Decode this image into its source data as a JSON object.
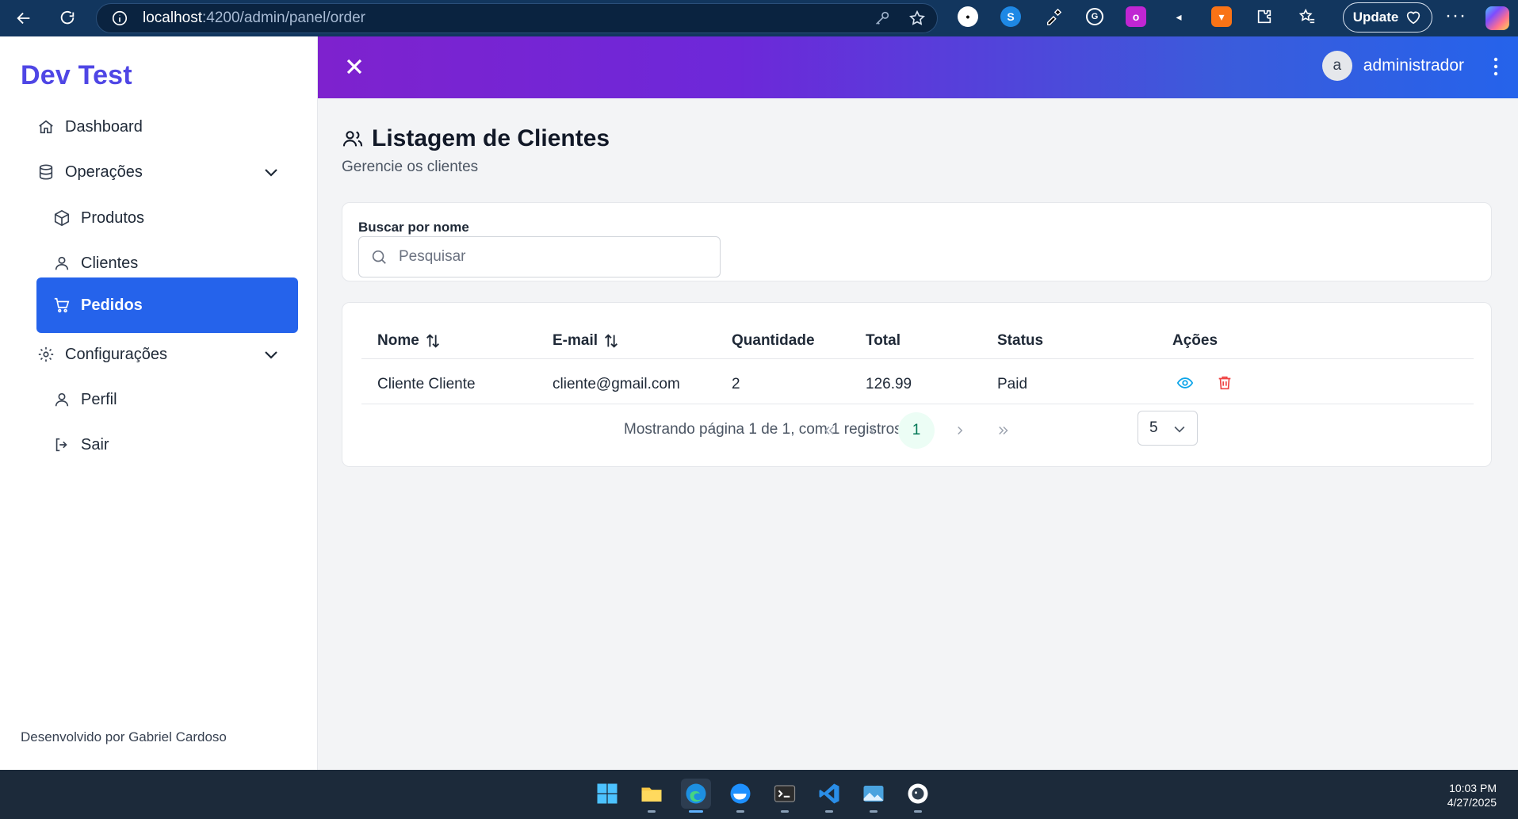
{
  "browser": {
    "url_host": "localhost",
    "url_path": ":4200/admin/panel/order",
    "update_label": "Update"
  },
  "sidebar": {
    "brand": "Dev Test",
    "items": [
      {
        "label": "Dashboard",
        "icon": "home-icon"
      },
      {
        "label": "Operações",
        "icon": "database-icon"
      },
      {
        "label": "Produtos",
        "icon": "box-icon"
      },
      {
        "label": "Clientes",
        "icon": "user-icon"
      },
      {
        "label": "Pedidos",
        "icon": "cart-icon"
      },
      {
        "label": "Configurações",
        "icon": "gear-icon"
      },
      {
        "label": "Perfil",
        "icon": "user-icon"
      },
      {
        "label": "Sair",
        "icon": "logout-icon"
      }
    ],
    "footer": "Desenvolvido por Gabriel Cardoso"
  },
  "topbar": {
    "avatar_letter": "a",
    "username": "administrador"
  },
  "page": {
    "title": "Listagem de Clientes",
    "subtitle": "Gerencie os clientes"
  },
  "search": {
    "label": "Buscar por nome",
    "placeholder": "Pesquisar",
    "value": ""
  },
  "table": {
    "columns": [
      "Nome",
      "E-mail",
      "Quantidade",
      "Total",
      "Status",
      "Ações"
    ],
    "rows": [
      {
        "nome": "Cliente Cliente",
        "email": "cliente@gmail.com",
        "quantidade": "2",
        "total": "126.99",
        "status": "Paid"
      }
    ]
  },
  "pagination": {
    "summary": "Mostrando página 1 de 1, com 1 registros",
    "current_page": "1",
    "page_size": "5"
  },
  "taskbar": {
    "time": "10:03 PM",
    "date": "4/27/2025"
  },
  "colors": {
    "primary": "#2563eb",
    "brand": "#4f46e5",
    "gradient_start": "#7e22ce",
    "gradient_end": "#2563eb",
    "view_action": "#0ea5e9",
    "delete_action": "#ef4444"
  }
}
